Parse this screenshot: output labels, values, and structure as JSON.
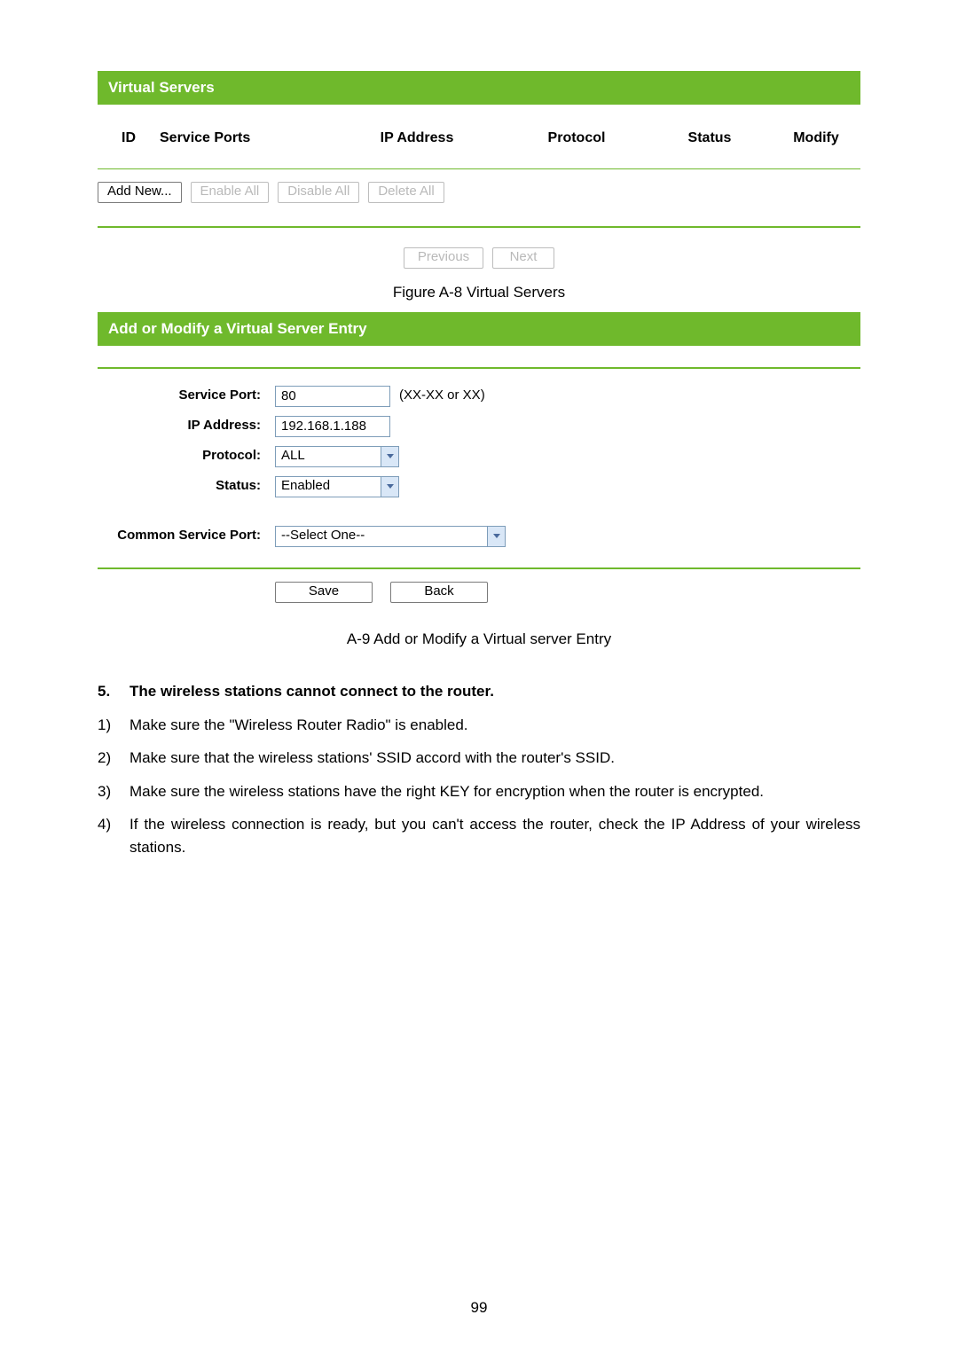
{
  "vs": {
    "title": "Virtual Servers",
    "cols": {
      "id": "ID",
      "sp": "Service Ports",
      "ip": "IP Address",
      "pr": "Protocol",
      "st": "Status",
      "mo": "Modify"
    },
    "buttons": {
      "add": "Add New...",
      "enable": "Enable All",
      "disable": "Disable All",
      "delete": "Delete All",
      "prev": "Previous",
      "next": "Next"
    },
    "caption": "Figure A-8   Virtual Servers"
  },
  "form": {
    "title": "Add or Modify a Virtual Server Entry",
    "labels": {
      "service_port": "Service Port:",
      "ip": "IP Address:",
      "protocol": "Protocol:",
      "status": "Status:",
      "common": "Common Service Port:"
    },
    "values": {
      "service_port": "80",
      "service_port_hint": "(XX-XX or XX)",
      "ip": "192.168.1.188",
      "protocol": "ALL",
      "status": "Enabled",
      "common": "--Select One--"
    },
    "buttons": {
      "save": "Save",
      "back": "Back"
    },
    "caption": "A-9 Add or Modify a Virtual server Entry"
  },
  "doc": {
    "q5_num": "5.",
    "q5": "The wireless stations cannot connect to the router.",
    "items": [
      {
        "n": "1)",
        "t": "Make sure the \"Wireless Router Radio\" is enabled."
      },
      {
        "n": "2)",
        "t": "Make sure that the wireless stations' SSID accord with the router's SSID."
      },
      {
        "n": "3)",
        "t": "Make sure the wireless stations have the right KEY for encryption when the router is encrypted."
      },
      {
        "n": "4)",
        "t": "If the wireless connection is ready, but you can't access the router, check the IP Address of your wireless stations."
      }
    ]
  },
  "page_number": "99"
}
